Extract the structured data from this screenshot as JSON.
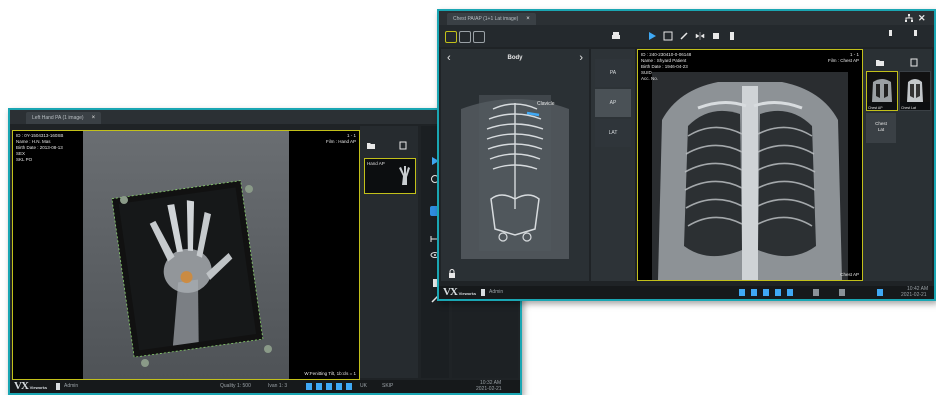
{
  "left_window": {
    "tab_title": "Left Hand PA (1 image)",
    "overlay_top_left": "ID : 0Y-1504313-160SB\nName : H.N. Mas\nBirth Date : 2013-08-13\nSEX\nSKL PO",
    "overlay_top_right": "1 - 1\nFilm : Hand AP",
    "overlay_bottom_right": "W:Fenitting Tilt, 1b:cls = 1",
    "thumb_label": "Hand AP",
    "status_items": [
      "Quality 1: 500",
      "Ivan 1: 3",
      "UK",
      "SKIP"
    ],
    "status_time": "10:32 AM",
    "status_date": "2021-02-21",
    "user": "Admin",
    "logo": "VX",
    "logo_sub": "Vieworks",
    "accent": "#1aa6b3",
    "highlight": "#c2c01a",
    "roi_color": "#d08a3a",
    "crop_color": "#2fe03a"
  },
  "right_window": {
    "tab_title": "Chest PA/AP (1+1 Lat image)",
    "body_title": "Body",
    "body_highlight": "Clavicle",
    "views": [
      "PA",
      "AP",
      "LAT"
    ],
    "overlay_top_left": "ID : 240-230410-0-06148\nName : Shyard Patient\nBirth Date : 1946-04-23\nSUID\nAcc. No.",
    "overlay_top_right": "1 - 1\nFilm : Chest AP",
    "overlay_bottom_right": "Chest AP",
    "thumbs": [
      "Chest AP",
      "Chest Lat"
    ],
    "thumb_selected_label": "Chest\nLat",
    "status_time": "10:42 AM",
    "status_date": "2021-02-21",
    "user": "Admin",
    "logo": "VX",
    "logo_sub": "Vieworks",
    "accent": "#1aa6b3",
    "highlight": "#c2c01a",
    "active_button": "#2f8ee0"
  }
}
